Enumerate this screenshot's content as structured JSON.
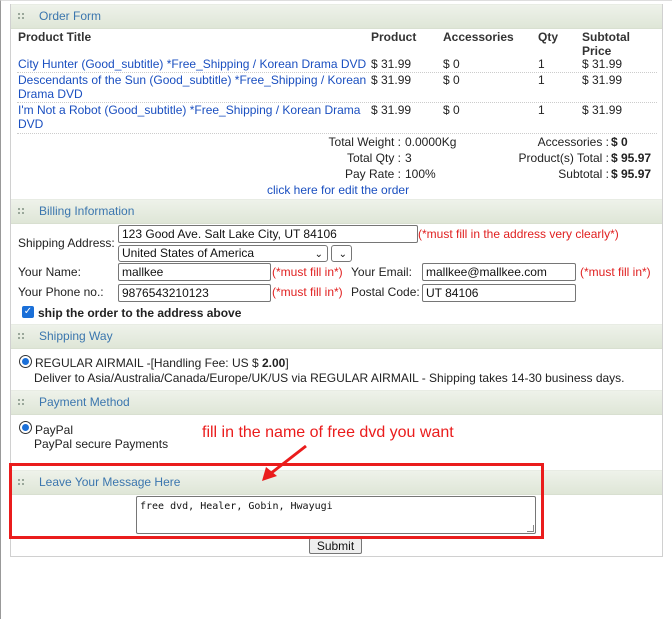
{
  "order_form": {
    "title": "Order Form",
    "headers": {
      "product_title": "Product Title",
      "product": "Product",
      "accessories": "Accessories",
      "qty": "Qty",
      "subtotal_line1": "Subtotal",
      "subtotal_line2": "Price"
    },
    "items": [
      {
        "title_line1": "City Hunter (Good_subtitle) *Free_Shipping / Korean Drama DVD",
        "title_line2": "",
        "product": "$ 31.99",
        "accessories": "$ 0",
        "qty": "1",
        "subtotal": "$ 31.99"
      },
      {
        "title_line1": "Descendants of the Sun (Good_subtitle) *Free_Shipping / Korean",
        "title_line2": "Drama DVD",
        "product": "$ 31.99",
        "accessories": "$ 0",
        "qty": "1",
        "subtotal": "$ 31.99"
      },
      {
        "title_line1": "I'm Not a Robot (Good_subtitle) *Free_Shipping / Korean Drama",
        "title_line2": "DVD",
        "product": "$ 31.99",
        "accessories": "$ 0",
        "qty": "1",
        "subtotal": "$ 31.99"
      }
    ],
    "totals": {
      "weight_label": "Total Weight :",
      "weight_value": "0.0000Kg",
      "qty_label": "Total Qty :",
      "qty_value": "3",
      "payrate_label": "Pay Rate :",
      "payrate_value": "100%",
      "accessories_label": "Accessories :",
      "accessories_value": "$ 0",
      "products_label": "Product(s) Total :",
      "products_value": "$ 95.97",
      "subtotal_label": "Subtotal :",
      "subtotal_value": "$ 95.97"
    },
    "edit_link": "click here for edit the order"
  },
  "billing": {
    "title": "Billing Information",
    "shipping_address_label": "Shipping Address:",
    "address_value": "123 Good Ave. Salt Lake City, UT 84106",
    "address_note": "(*must fill in the address very clearly*)",
    "country_value": "United States of America",
    "name_label": "Your Name:",
    "name_value": "mallkee",
    "name_note": "(*must fill in*)",
    "email_label": "Your Email:",
    "email_value": "mallkee@mallkee.com",
    "email_note": "(*must fill in*)",
    "phone_label": "Your Phone no.:",
    "phone_value": "9876543210123",
    "phone_note": "(*must fill in*)",
    "postal_label": "Postal Code:",
    "postal_value": "UT 84106",
    "ship_same_label": "ship the order to the address above"
  },
  "shipping_way": {
    "title": "Shipping Way",
    "option_prefix": "REGULAR AIRMAIL -[Handling Fee: US $ ",
    "option_fee": "2.00",
    "option_suffix": "]",
    "option_desc": "Deliver to Asia/Australia/Canada/Europe/UK/US via REGULAR AIRMAIL - Shipping takes 14-30 business days."
  },
  "payment": {
    "title": "Payment Method",
    "option_label": "PayPal",
    "option_desc": "PayPal secure Payments"
  },
  "message": {
    "title": "Leave Your Message Here",
    "value": "free dvd, Healer, Gobin, Hwayugi"
  },
  "annotation": {
    "callout_text": "fill in the name of free dvd you want",
    "color": "#ea1c1c"
  },
  "submit_label": "Submit",
  "colors": {
    "section_title": "#3b76ae",
    "link": "#1a4fc0",
    "required_note": "#e02020",
    "accent": "#1a6fd8"
  }
}
